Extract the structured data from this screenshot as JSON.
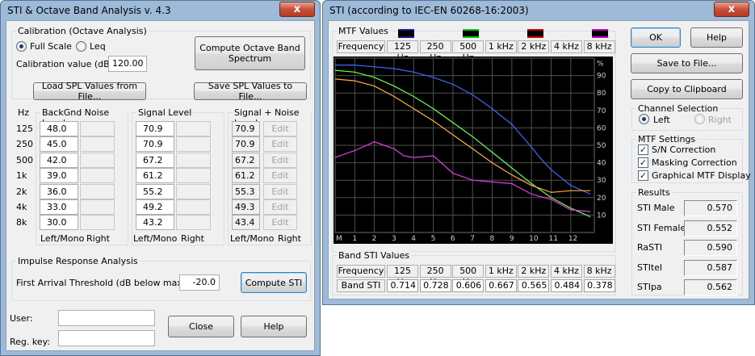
{
  "left": {
    "title": "STI & Octave Band Analysis v. 4.3",
    "close_glyph": "x",
    "calibration": {
      "group_label": "Calibration (Octave Analysis)",
      "radio_full": "Full Scale",
      "radio_leq": "Leq",
      "value_label": "Calibration value (dB):",
      "value": "120.00",
      "compute_octave": "Compute Octave Band Spectrum"
    },
    "load_spl": "Load SPL Values from File...",
    "save_spl": "Save SPL Values to File...",
    "hz_label": "Hz",
    "bands": [
      "125",
      "250",
      "500",
      "1k",
      "2k",
      "4k",
      "8k"
    ],
    "bg_noise": {
      "label": "BackGnd Noise Level",
      "values": [
        "48.0",
        "45.0",
        "42.0",
        "39.0",
        "36.0",
        "33.0",
        "30.0"
      ],
      "left_mono": "Left/Mono",
      "right": "Right"
    },
    "signal": {
      "label": "Signal Level",
      "values": [
        "70.9",
        "70.9",
        "67.2",
        "61.2",
        "55.2",
        "49.2",
        "43.2"
      ],
      "left_mono": "Left/Mono",
      "right": "Right"
    },
    "sn": {
      "label": "Signal + Noise Level",
      "values": [
        "70.9",
        "70.9",
        "67.2",
        "61.2",
        "55.3",
        "49.3",
        "43.4"
      ],
      "edit": "Edit",
      "left_mono": "Left/Mono",
      "right": "Right"
    },
    "impulse": {
      "group_label": "Impulse Response Analysis",
      "threshold_label": "First Arrival Threshold (dB below max.):",
      "threshold": "-20.0",
      "compute_sti": "Compute STI"
    },
    "user_label": "User:",
    "regkey_label": "Reg. key:",
    "close_btn": "Close",
    "help_btn": "Help"
  },
  "right": {
    "title": "STI (according to IEC-EN 60268-16:2003)",
    "close_glyph": "x",
    "mtf": {
      "group_label": "MTF Values",
      "freq_label": "Frequency",
      "freqs": [
        "125 Hz",
        "250 Hz",
        "500 Hz",
        "1 kHz",
        "2 kHz",
        "4 kHz",
        "8 kHz"
      ],
      "legend_colors": [
        "#1a1a8a",
        "#00cc00",
        "#cc0000",
        "#cc00cc"
      ]
    },
    "chart_data": {
      "type": "line",
      "x_ticks": [
        "M",
        "1",
        "2",
        "3",
        "4",
        "5",
        "6",
        "7",
        "8",
        "9",
        "10",
        "11",
        "12"
      ],
      "y_ticks": [
        "%",
        "90",
        "80",
        "70",
        "60",
        "50",
        "40",
        "30",
        "20",
        "10"
      ],
      "ylim": [
        0,
        100
      ],
      "xlim": [
        0,
        13.2
      ],
      "grid": true,
      "series": [
        {
          "color": "#3a6aff",
          "x": [
            0,
            1,
            2,
            3,
            4,
            5,
            6,
            7,
            8,
            9,
            10,
            10.5,
            11,
            12,
            13
          ],
          "y": [
            96,
            96,
            95,
            94,
            92,
            89,
            85,
            79,
            71,
            62,
            49,
            42,
            36,
            27,
            22
          ]
        },
        {
          "color": "#6aff4a",
          "x": [
            0,
            1,
            2,
            3,
            4,
            5,
            6,
            7,
            8,
            9,
            10,
            11,
            12,
            13
          ],
          "y": [
            93,
            92,
            89,
            84,
            78,
            71,
            63,
            55,
            46,
            37,
            28,
            20,
            14,
            9
          ]
        },
        {
          "color": "#ffb040",
          "x": [
            0,
            1,
            2,
            3,
            4,
            5,
            6,
            7,
            8,
            9,
            10,
            11,
            12,
            13
          ],
          "y": [
            88,
            87,
            84,
            78,
            71,
            64,
            56,
            48,
            40,
            33,
            27,
            23,
            24,
            24
          ]
        },
        {
          "color": "#e040e0",
          "x": [
            0,
            1,
            2,
            3,
            3.5,
            4,
            5,
            6,
            7,
            8,
            9,
            10,
            11,
            12,
            13
          ],
          "y": [
            43,
            47,
            52,
            48,
            44,
            43,
            44,
            34,
            30,
            29,
            28,
            22,
            19,
            13,
            12
          ]
        }
      ]
    },
    "band_sti": {
      "group_label": "Band STI Values",
      "freq_label": "Frequency",
      "freqs": [
        "125 Hz",
        "250 Hz",
        "500 Hz",
        "1 kHz",
        "2 kHz",
        "4 kHz",
        "8 kHz"
      ],
      "row_label": "Band STI",
      "values": [
        "0.714",
        "0.728",
        "0.606",
        "0.667",
        "0.565",
        "0.484",
        "0.378"
      ]
    },
    "ok": "OK",
    "help": "Help",
    "save_file": "Save to File...",
    "copy_clip": "Copy to Clipboard",
    "channel": {
      "group_label": "Channel Selection",
      "left": "Left",
      "right": "Right"
    },
    "mtf_settings": {
      "group_label": "MTF Settings",
      "sn": "S/N Correction",
      "masking": "Masking Correction",
      "graphical": "Graphical MTF Display",
      "check": "✓"
    },
    "results": {
      "group_label": "Results",
      "items": [
        {
          "label": "STI Male",
          "value": "0.570"
        },
        {
          "label": "STI Female",
          "value": "0.552"
        },
        {
          "label": "RaSTI",
          "value": "0.590"
        },
        {
          "label": "STItel",
          "value": "0.587"
        },
        {
          "label": "STIpa",
          "value": "0.562"
        }
      ]
    }
  }
}
